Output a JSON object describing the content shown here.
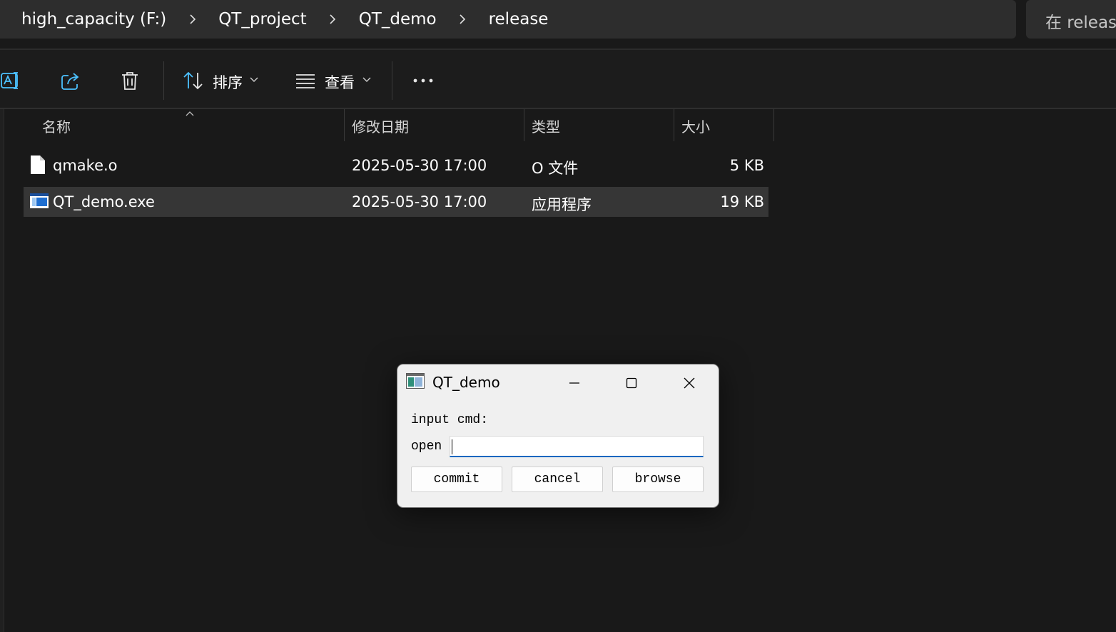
{
  "explorer": {
    "breadcrumb": [
      "high_capacity (F:)",
      "QT_project",
      "QT_demo",
      "release"
    ],
    "search_placeholder": "在 release",
    "toolbar": {
      "sort_label": "排序",
      "view_label": "查看"
    },
    "columns": {
      "name": "名称",
      "modified": "修改日期",
      "type": "类型",
      "size": "大小"
    },
    "files": [
      {
        "name": "qmake.o",
        "modified": "2025-05-30 17:00",
        "type": "O 文件",
        "size": "5 KB",
        "icon": "document-icon",
        "selected": false
      },
      {
        "name": "QT_demo.exe",
        "modified": "2025-05-30 17:00",
        "type": "应用程序",
        "size": "19 KB",
        "icon": "application-icon",
        "selected": true
      }
    ]
  },
  "dialog": {
    "title": "QT_demo",
    "label_input_cmd": "input cmd:",
    "label_open": "open",
    "input_value": "",
    "buttons": {
      "commit": "commit",
      "cancel": "cancel",
      "browse": "browse"
    }
  },
  "colors": {
    "background": "#191919",
    "address_bar": "#2d2d2d",
    "selected_row": "#363636",
    "dialog_bg": "#f0f0f0",
    "input_focus_accent": "#0067c0"
  }
}
